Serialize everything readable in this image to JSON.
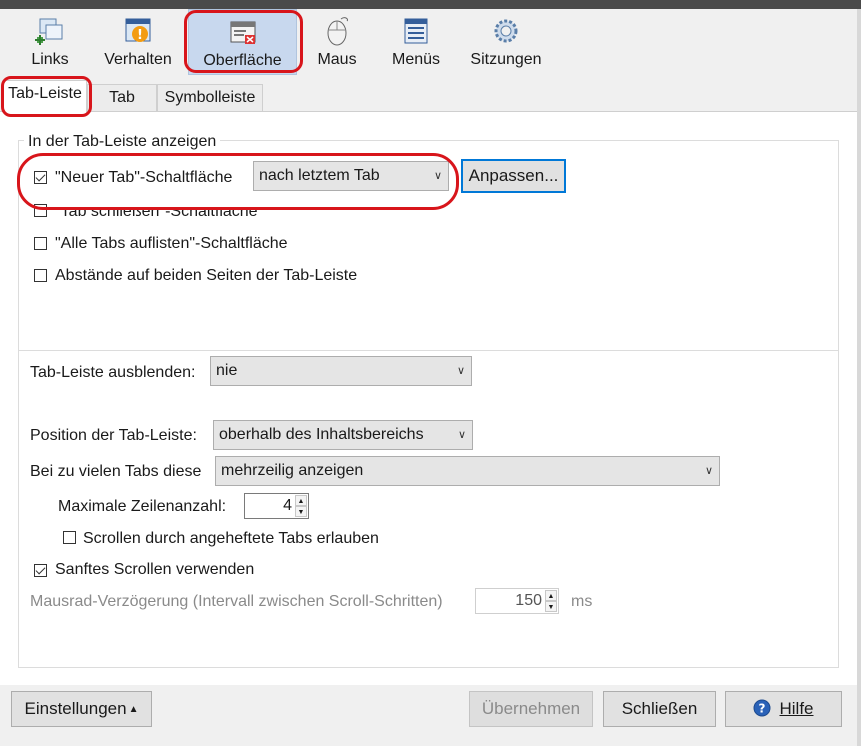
{
  "toolbar": {
    "items": [
      {
        "label": "Links",
        "icon": "links-icon"
      },
      {
        "label": "Verhalten",
        "icon": "behavior-icon"
      },
      {
        "label": "Oberfläche",
        "icon": "appearance-icon",
        "selected": true
      },
      {
        "label": "Maus",
        "icon": "mouse-icon"
      },
      {
        "label": "Menüs",
        "icon": "menus-icon"
      },
      {
        "label": "Sitzungen",
        "icon": "sessions-icon"
      }
    ]
  },
  "tabs": [
    {
      "label": "Tab-Leiste",
      "active": true
    },
    {
      "label": "Tab"
    },
    {
      "label": "Symbolleiste"
    }
  ],
  "show_group": {
    "title": "In der Tab-Leiste anzeigen",
    "new_tab_label": "\"Neuer Tab\"-Schaltfläche",
    "new_tab_checked": true,
    "new_tab_position": "nach letztem Tab",
    "customize_button": "Anpassen...",
    "close_tab_label": "\"Tab schließen\"-Schaltfläche",
    "close_tab_checked": false,
    "all_tabs_label": "\"Alle Tabs auflisten\"-Schaltfläche",
    "all_tabs_checked": false,
    "spacing_label": "Abstände auf beiden Seiten der Tab-Leiste",
    "spacing_checked": false
  },
  "options": {
    "hide_label": "Tab-Leiste ausblenden:",
    "hide_value": "nie",
    "position_label": "Position der Tab-Leiste:",
    "position_value": "oberhalb des Inhaltsbereichs",
    "many_tabs_label": "Bei zu vielen Tabs diese",
    "many_tabs_value": "mehrzeilig anzeigen",
    "max_rows_label": "Maximale Zeilenanzahl:",
    "max_rows_value": "4",
    "scroll_pinned_label": "Scrollen durch angeheftete Tabs erlauben",
    "scroll_pinned_checked": false,
    "smooth_scroll_label": "Sanftes Scrollen verwenden",
    "smooth_scroll_checked": true,
    "wheel_delay_label": "Mausrad-Verzögerung (Intervall zwischen Scroll-Schritten)",
    "wheel_delay_value": "150",
    "wheel_delay_unit": "ms"
  },
  "bottom": {
    "settings_button": "Einstellungen",
    "apply_button": "Übernehmen",
    "close_button": "Schließen",
    "help_button": "Hilfe"
  },
  "colors": {
    "highlight_red": "#d8151b",
    "selected_bg": "#c8d8ee",
    "focus_blue": "#0078d7"
  }
}
